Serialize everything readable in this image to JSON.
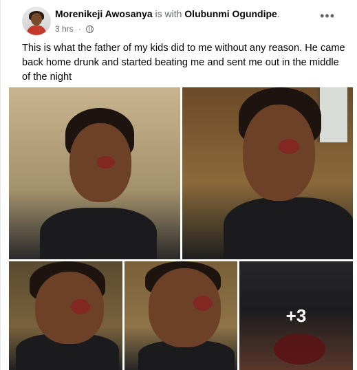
{
  "post": {
    "author": "Morenikeji Awosanya",
    "with_text": " is with ",
    "tagged": "Olubunmi Ogundipe",
    "punctuation": ".",
    "time": "3 hrs",
    "separator": " · ",
    "privacy_icon": "globe-icon",
    "more_icon": "•••",
    "text": "This is what the father of my kids did to me without any reason. He came back home drunk and started beating me and sent me out in the middle of the night",
    "photos_more_label": "+3"
  }
}
